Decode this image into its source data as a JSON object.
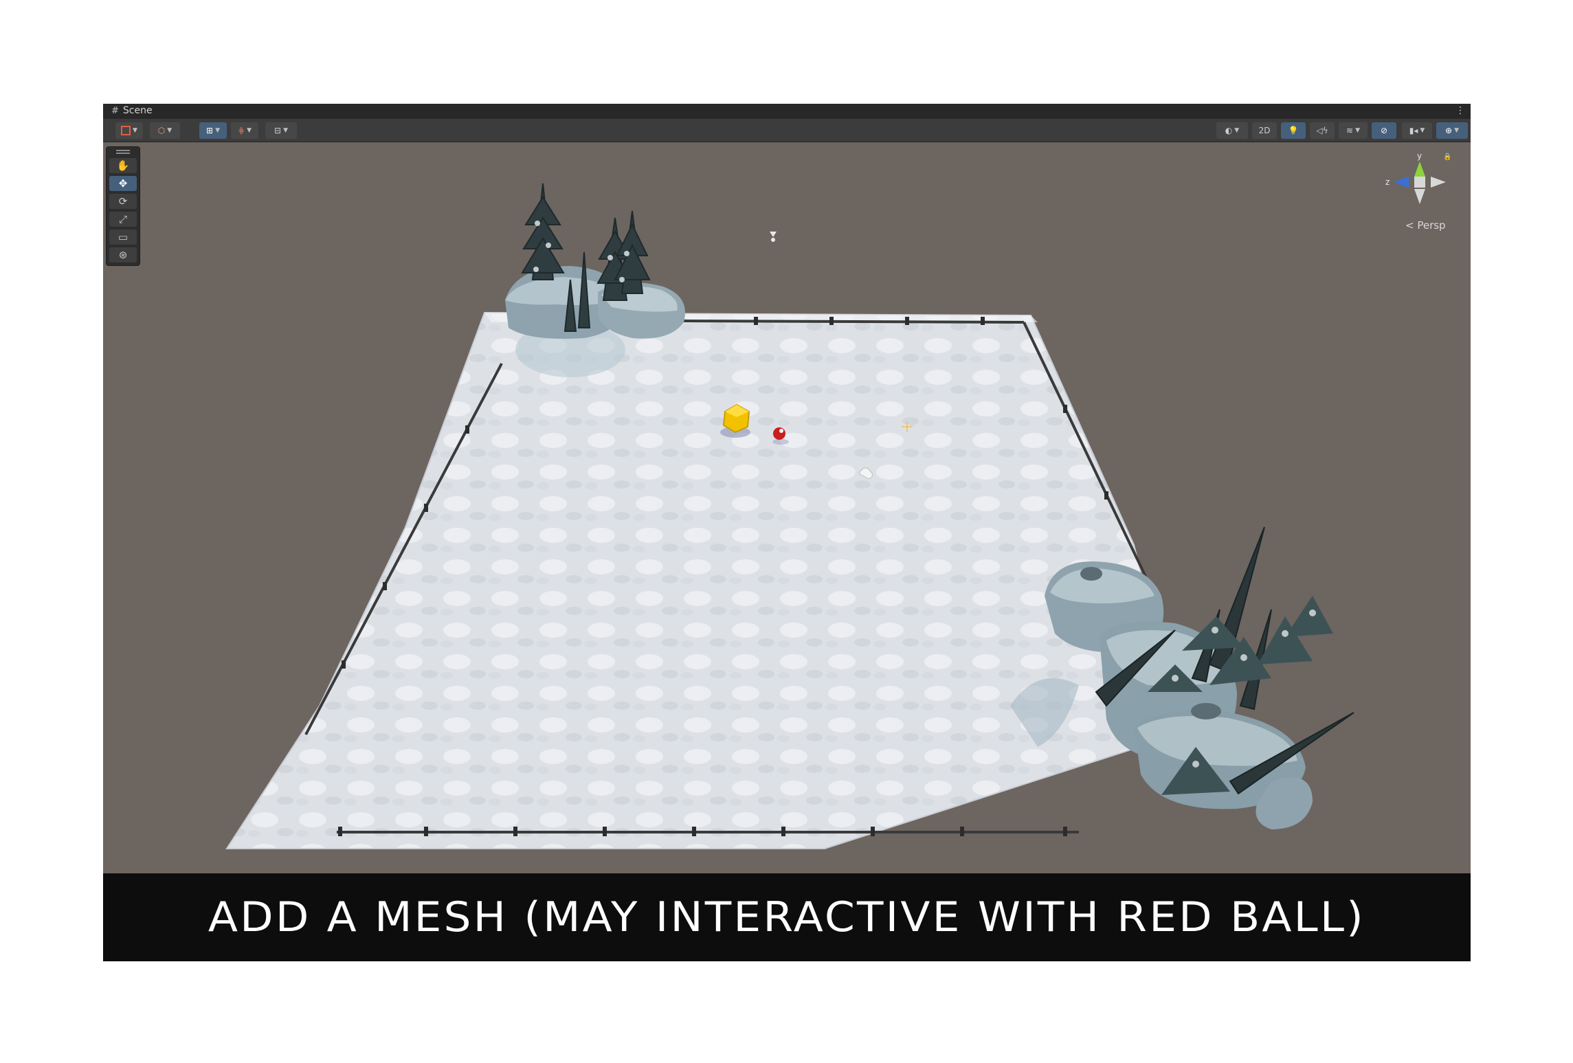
{
  "window": {
    "tab_title": "Scene",
    "tab_icon": "grid-icon",
    "menu_icon": "kebab-menu-icon"
  },
  "toolbar": {
    "left_tools": [
      "draw-mode-icon",
      "shading-mode-icon",
      "grid-snap-icon",
      "increment-snap-icon",
      "align-icon"
    ],
    "toggle_2d_label": "2D",
    "right_tools": [
      "render-mode-icon",
      "lighting-icon",
      "audio-icon",
      "effects-icon",
      "visibility-icon",
      "camera-icon",
      "gizmos-icon"
    ]
  },
  "tool_palette": {
    "tools": [
      "hand-tool-icon",
      "move-tool-icon",
      "rotate-tool-icon",
      "scale-tool-icon",
      "rect-tool-icon",
      "transform-tool-icon"
    ],
    "active": "move-tool-icon"
  },
  "gizmo": {
    "y_label": "y",
    "z_label": "z",
    "persp_label": "< Persp",
    "lock_icon": "lock-icon"
  },
  "scene": {
    "objects": [
      "snow-ground-mesh",
      "fence",
      "rock-cluster-with-pines",
      "yellow-mesh-object",
      "red-ball",
      "light-icon",
      "camera-icon",
      "audio-source-icon"
    ]
  },
  "caption": {
    "text": "ADD A MESH (MAY INTERACTIVE WITH RED BALL)"
  },
  "colors": {
    "viewport_bg": "#6d6560",
    "snow": "#dfe3e8",
    "rock": "#8fa4b0",
    "pine": "#2c3a3c",
    "yellow_mesh": "#f2c200",
    "red_ball": "#c81e1e",
    "active_tool": "#46607c"
  }
}
